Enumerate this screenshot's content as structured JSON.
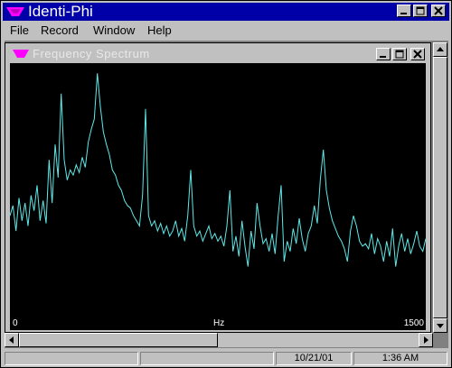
{
  "app": {
    "title": "Identi-Phi"
  },
  "menu": {
    "file": "File",
    "record": "Record",
    "window": "Window",
    "help": "Help"
  },
  "child": {
    "title": "Frequency Spectrum"
  },
  "axis": {
    "x_min": "0",
    "x_label": "Hz",
    "x_max": "1500"
  },
  "status": {
    "date": "10/21/01",
    "time": "1:36 AM"
  },
  "colors": {
    "titlebar": "#0000a8",
    "trace": "#5ee8e8",
    "plot_bg": "#000000",
    "app_icon": "#ff00ff"
  },
  "chart_data": {
    "type": "line",
    "xlabel": "Hz",
    "xlim": [
      0,
      1500
    ],
    "x_ticks": [
      "0",
      "1500"
    ],
    "grid": false,
    "peaks_hz": [
      160,
      310,
      460,
      620,
      770,
      930,
      1080
    ],
    "series": [
      {
        "values": [
          0.4,
          0.44,
          0.34,
          0.47,
          0.38,
          0.45,
          0.36,
          0.48,
          0.42,
          0.52,
          0.38,
          0.46,
          0.37,
          0.62,
          0.45,
          0.68,
          0.55,
          0.88,
          0.62,
          0.54,
          0.58,
          0.56,
          0.6,
          0.57,
          0.63,
          0.59,
          0.69,
          0.74,
          0.78,
          0.96,
          0.83,
          0.73,
          0.68,
          0.64,
          0.58,
          0.56,
          0.52,
          0.5,
          0.46,
          0.44,
          0.43,
          0.4,
          0.38,
          0.36,
          0.48,
          0.82,
          0.4,
          0.36,
          0.38,
          0.34,
          0.37,
          0.33,
          0.36,
          0.32,
          0.34,
          0.38,
          0.32,
          0.35,
          0.3,
          0.4,
          0.58,
          0.36,
          0.32,
          0.34,
          0.3,
          0.33,
          0.36,
          0.31,
          0.33,
          0.3,
          0.32,
          0.28,
          0.36,
          0.5,
          0.26,
          0.32,
          0.24,
          0.38,
          0.28,
          0.2,
          0.34,
          0.27,
          0.45,
          0.36,
          0.29,
          0.31,
          0.26,
          0.33,
          0.25,
          0.4,
          0.52,
          0.22,
          0.3,
          0.26,
          0.35,
          0.29,
          0.39,
          0.31,
          0.26,
          0.33,
          0.36,
          0.44,
          0.37,
          0.54,
          0.66,
          0.5,
          0.43,
          0.38,
          0.35,
          0.32,
          0.3,
          0.27,
          0.22,
          0.34,
          0.4,
          0.36,
          0.3,
          0.28,
          0.29,
          0.27,
          0.33,
          0.25,
          0.31,
          0.28,
          0.22,
          0.3,
          0.24,
          0.35,
          0.2,
          0.28,
          0.33,
          0.26,
          0.31,
          0.25,
          0.29,
          0.34,
          0.28,
          0.26,
          0.31
        ]
      }
    ]
  }
}
